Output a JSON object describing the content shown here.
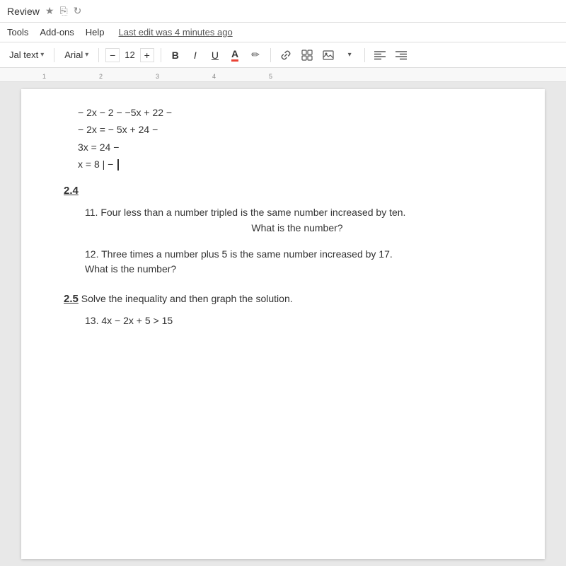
{
  "titleBar": {
    "title": "Review",
    "starLabel": "★",
    "saveIcon": "💾",
    "refreshIcon": "↻"
  },
  "menuBar": {
    "items": [
      "Tools",
      "Add-ons",
      "Help"
    ],
    "lastEdit": "Last edit was 4 minutes ago"
  },
  "toolbar": {
    "styleDropdown": "Jal text",
    "fontDropdown": "Arial",
    "fontSizeMinus": "−",
    "fontSize": "12",
    "fontSizePlus": "+",
    "boldLabel": "B",
    "italicLabel": "I",
    "underlineLabel": "U",
    "colorLabel": "A",
    "pencilIcon": "✏",
    "linkIcon": "🔗",
    "addIcon": "⊞",
    "imgIcon": "🖼",
    "alignLeft": "≡",
    "alignRight": "≡"
  },
  "ruler": {
    "marks": [
      "1",
      "2",
      "3",
      "4",
      "5"
    ]
  },
  "document": {
    "mathLines": [
      "− 2x − 2 − −5x + 22  −",
      "− 2x =  − 5x + 24   −",
      "3x = 24   −",
      "x = 8      |   −"
    ],
    "section24": "2.4",
    "problem11": {
      "number": "11.",
      "line1": "Four less than a number tripled is the same number increased by ten.",
      "line2": "What is the number?"
    },
    "problem12": {
      "number": "12.",
      "line1": "Three times a number plus 5 is the same number increased by 17.",
      "line2": "What is the number?"
    },
    "section25Header": "2.5",
    "section25Desc": " Solve the inequality and then graph the solution.",
    "problem13": {
      "number": "13.",
      "text": "4x − 2x + 5 > 15"
    }
  }
}
